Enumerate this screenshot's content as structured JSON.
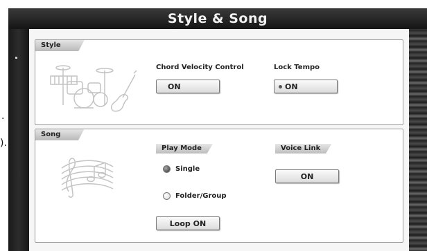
{
  "page_title": "Style & Song",
  "stray_text": {
    "left_dot": ".",
    "left_paren": ")."
  },
  "style_panel": {
    "tab_label": "Style",
    "illustration_icon": "drums-guitar-icon",
    "chord_velocity": {
      "label": "Chord Velocity Control",
      "value": "ON"
    },
    "lock_tempo": {
      "label": "Lock Tempo",
      "value": "ON"
    }
  },
  "song_panel": {
    "tab_label": "Song",
    "illustration_icon": "music-note-icon",
    "play_mode": {
      "label": "Play Mode",
      "options": [
        {
          "label": "Single",
          "selected": true
        },
        {
          "label": "Folder/Group",
          "selected": false
        }
      ]
    },
    "voice_link": {
      "label": "Voice Link",
      "value": "ON"
    },
    "loop_button": "Loop ON"
  }
}
